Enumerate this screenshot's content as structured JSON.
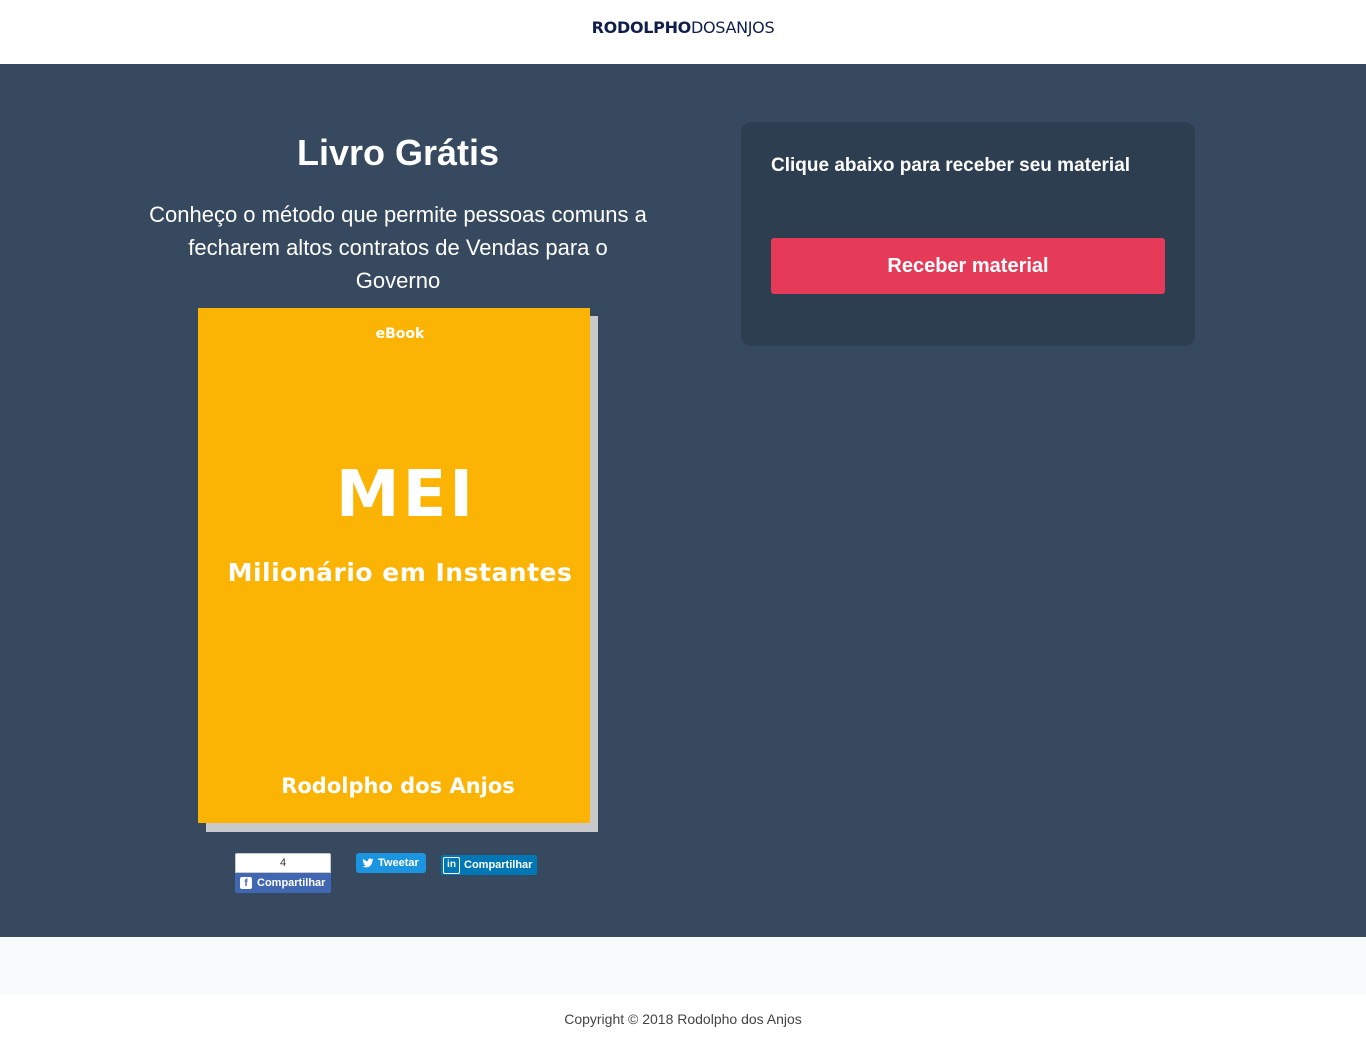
{
  "header": {
    "logo_bold": "RODOLPHO",
    "logo_light": "DOSANJOS"
  },
  "hero": {
    "title": "Livro Grátis",
    "subtitle": "Conheço o método que permite pessoas comuns a fecharem altos contratos de Vendas para o Governo"
  },
  "book": {
    "tag": "eBook",
    "title": "MEI",
    "subtitle": "Milionário em Instantes",
    "author": "Rodolpho dos Anjos",
    "cover_color": "#fbb304"
  },
  "share": {
    "facebook_count": "4",
    "facebook_label": "Compartilhar",
    "twitter_label": "Tweetar",
    "linkedin_label": "Compartilhar"
  },
  "panel": {
    "title": "Clique abaixo para receber seu material",
    "button_label": "Receber material",
    "button_color": "#e63b58"
  },
  "footer": {
    "copyright": "Copyright © 2018 Rodolpho dos Anjos"
  },
  "icons": [
    "facebook-icon",
    "twitter-icon",
    "linkedin-icon"
  ]
}
